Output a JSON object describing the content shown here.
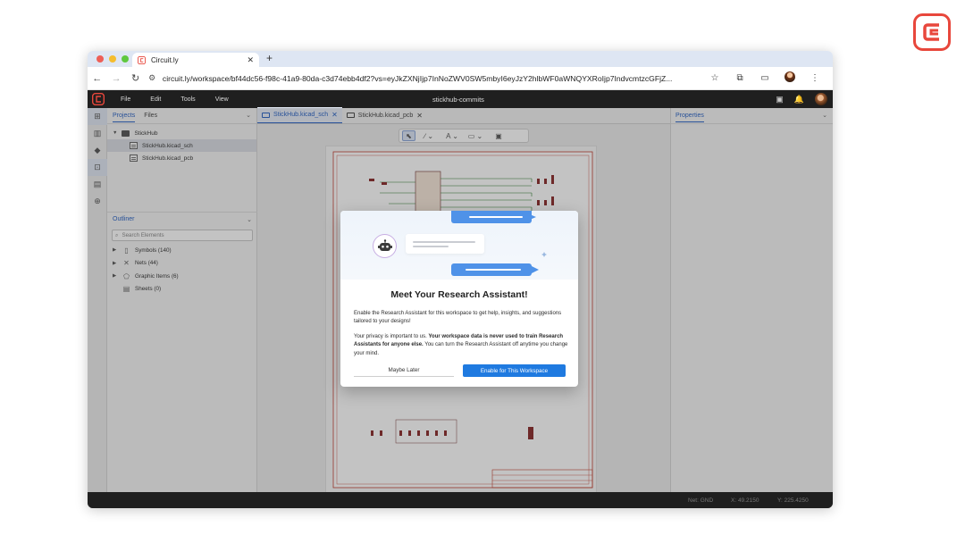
{
  "browser": {
    "tab_title": "Circuit.ly",
    "url": "circuit.ly/workspace/bf44dc56-f98c-41a9-80da-c3d74ebb4df2?vs=eyJkZXNjIjp7InNoZWV0SW5mbyI6eyJzY2hlbWF0aWNQYXRoIjp7IndvcmtzcGFjZ..."
  },
  "app": {
    "menu": [
      "File",
      "Edit",
      "Tools",
      "View"
    ],
    "project_name": "stickhub-commits"
  },
  "left_panel": {
    "tabs": [
      "Projects",
      "Files"
    ],
    "tree": {
      "folder": "StickHub",
      "files": [
        "StickHub.kicad_sch",
        "StickHub.kicad_pcb"
      ]
    },
    "outliner": {
      "title": "Outliner",
      "search_placeholder": "Search Elements",
      "items": [
        "Symbols (140)",
        "Nets (44)",
        "Graphic Items (6)",
        "Sheets (0)"
      ]
    }
  },
  "editor": {
    "tabs": [
      "StickHub.kicad_sch",
      "StickHub.kicad_pcb"
    ],
    "toolbar": [
      "select-tool",
      "line-tool",
      "text-tool",
      "shape-tool",
      "comment-tool"
    ]
  },
  "right_panel": {
    "title": "Properties"
  },
  "status": {
    "net": "Net: GND",
    "x": "X: 49.2150",
    "y": "Y: 225.4250"
  },
  "modal": {
    "title": "Meet Your Research Assistant!",
    "para1": "Enable the Research Assistant for this workspace to get help, insights, and suggestions tailored to your designs!",
    "para2_a": "Your privacy is important to us. ",
    "para2_b": "Your workspace data is never used to train Research Assistants for anyone else.",
    "para2_c": " You can turn the Research Assistant off anytime you change your mind.",
    "later_label": "Maybe Later",
    "enable_label": "Enable for This Workspace"
  },
  "colors": {
    "brand": "#e8473c",
    "accent": "#1f7ae0",
    "schematic_border": "#c0392b"
  }
}
